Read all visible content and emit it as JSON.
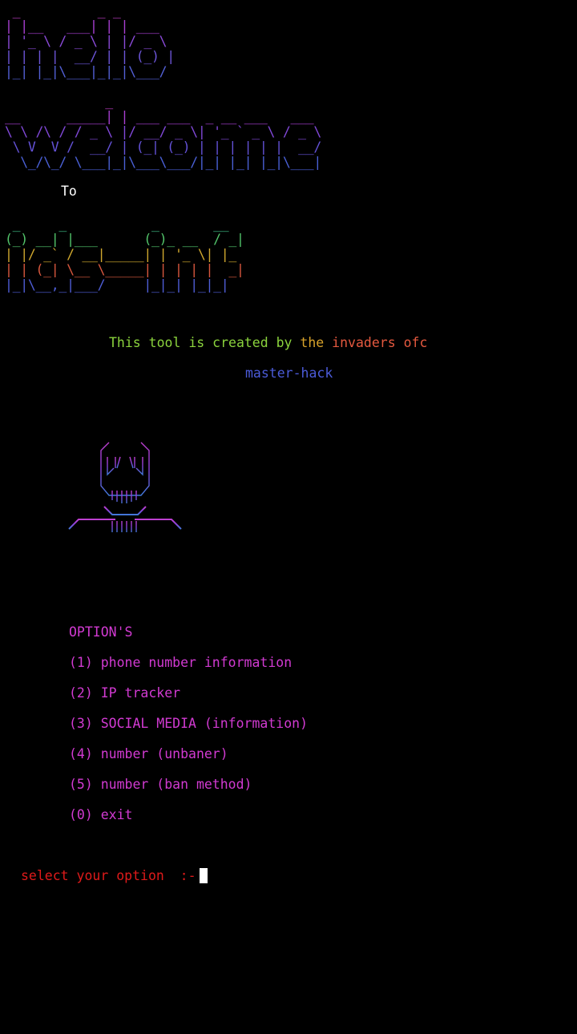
{
  "banner": {
    "hello_lines": [
      " _          _ _       ",
      "| |__   ___| | | ___  ",
      "| '_ \\ / _ \\ | |/ _ \\ ",
      "| | | |  __/ | | (_) |",
      "|_| |_|\\___|_|_|\\___/ "
    ],
    "welcome_lines": [
      "             _                          ",
      "__      _____| | ___ ___  _ __ ___   ___ ",
      "\\ \\ /\\ / / _ \\ |/ __/ _ \\| '_ ` _ \\ / _ \\",
      " \\ V  V /  __/ | (_| (_) | | | | | |  __/",
      "  \\_/\\_/ \\___|_|\\___\\___/|_| |_| |_|\\___|"
    ],
    "to_label": "To",
    "lbs_lines": [
      " _     _           _       __ ",
      "(_) __| |___      (_)_ __  / _|",
      "| |/ _` / __|_____| | '_ \\| |_ ",
      "| | (_| \\__ \\_____| | | | |  _|",
      "|_|\\__,_|___/     |_|_| |_|_|  "
    ]
  },
  "credits": {
    "part1": "This tool is created by",
    "part2": "the",
    "part3": "invaders ofc",
    "name": "master-hack"
  },
  "options": {
    "heading": "OPTION'S",
    "items": [
      "(1) phone number information",
      "(2) IP tracker",
      "(3) SOCIAL MEDIA (information)",
      "(4) number (unbaner)",
      "(5) number (ban method)",
      "(0) exit"
    ]
  },
  "prompt": {
    "label": "select your option  :-"
  },
  "colors": {
    "background": "#000000",
    "magenta": "#d23ad2",
    "prompt_red": "#e01a1a",
    "credit_green": "#8bd33d",
    "credit_yellow": "#d8a22a",
    "credit_red": "#e5593f",
    "credit_blue": "#4b5bd9"
  }
}
